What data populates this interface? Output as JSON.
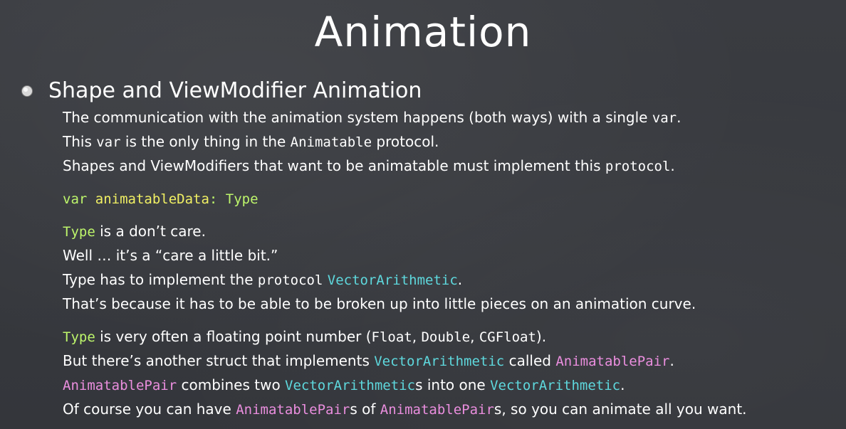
{
  "slide": {
    "title": "Animation",
    "bullet": {
      "icon": "bullet-circle-icon",
      "heading": "Shape and ViewModifier Animation"
    },
    "paragraphs": [
      [
        {
          "t": "The communication with the animation system happens (both ways) with a single ",
          "c": "plain"
        },
        {
          "t": "var",
          "c": "plain",
          "mono": true
        },
        {
          "t": ".",
          "c": "plain"
        }
      ],
      [
        {
          "t": "This ",
          "c": "plain"
        },
        {
          "t": "var",
          "c": "plain",
          "mono": true
        },
        {
          "t": " is the only thing in the ",
          "c": "plain"
        },
        {
          "t": "Animatable",
          "c": "plain",
          "mono": true
        },
        {
          "t": " protocol.",
          "c": "plain"
        }
      ],
      [
        {
          "t": "Shapes and ViewModifiers that want to be animatable must implement this ",
          "c": "plain"
        },
        {
          "t": "protocol",
          "c": "plain",
          "mono": true
        },
        {
          "t": ".",
          "c": "plain"
        }
      ],
      "gap",
      [
        {
          "t": "var ",
          "c": "green",
          "mono": true
        },
        {
          "t": "animatableData",
          "c": "yellow",
          "mono": true
        },
        {
          "t": ": Type",
          "c": "green",
          "mono": true
        }
      ],
      "gap",
      [
        {
          "t": "Type",
          "c": "green",
          "mono": true
        },
        {
          "t": " is a don’t care.",
          "c": "plain"
        }
      ],
      [
        {
          "t": "Well … it’s a “care a little bit.”",
          "c": "plain"
        }
      ],
      [
        {
          "t": "Type has to implement the ",
          "c": "plain"
        },
        {
          "t": "protocol",
          "c": "plain",
          "mono": true
        },
        {
          "t": " ",
          "c": "plain"
        },
        {
          "t": "VectorArithmetic",
          "c": "cyan",
          "mono": true
        },
        {
          "t": ".",
          "c": "plain"
        }
      ],
      [
        {
          "t": "That’s because it has to be able to be broken up into little pieces on an animation curve.",
          "c": "plain"
        }
      ],
      "gap",
      [
        {
          "t": "Type",
          "c": "green",
          "mono": true
        },
        {
          "t": " is very often a floating point number (",
          "c": "plain"
        },
        {
          "t": "Float",
          "c": "plain",
          "mono": true
        },
        {
          "t": ", ",
          "c": "plain"
        },
        {
          "t": "Double",
          "c": "plain",
          "mono": true
        },
        {
          "t": ", ",
          "c": "plain"
        },
        {
          "t": "CGFloat",
          "c": "plain",
          "mono": true
        },
        {
          "t": ").",
          "c": "plain"
        }
      ],
      [
        {
          "t": "But there’s another struct that implements ",
          "c": "plain"
        },
        {
          "t": "VectorArithmetic",
          "c": "cyan",
          "mono": true
        },
        {
          "t": " called ",
          "c": "plain"
        },
        {
          "t": "AnimatablePair",
          "c": "pink",
          "mono": true
        },
        {
          "t": ".",
          "c": "plain"
        }
      ],
      [
        {
          "t": "AnimatablePair",
          "c": "pink",
          "mono": true
        },
        {
          "t": " combines two ",
          "c": "plain"
        },
        {
          "t": "VectorArithmetic",
          "c": "cyan",
          "mono": true
        },
        {
          "t": "s into one ",
          "c": "plain"
        },
        {
          "t": "VectorArithmetic",
          "c": "cyan",
          "mono": true
        },
        {
          "t": ".",
          "c": "plain"
        }
      ],
      [
        {
          "t": "Of course you can have ",
          "c": "plain"
        },
        {
          "t": "AnimatablePair",
          "c": "pink",
          "mono": true
        },
        {
          "t": "s of ",
          "c": "plain"
        },
        {
          "t": "AnimatablePair",
          "c": "pink",
          "mono": true
        },
        {
          "t": "s, so you can animate all you want.",
          "c": "plain"
        }
      ]
    ]
  },
  "colors": {
    "background": "#37393e",
    "text": "#ffffff",
    "keyword_green": "#bdf56b",
    "identifier_yellow": "#f0ef63",
    "protocol_cyan": "#5ed8dd",
    "struct_pink": "#ea8ede"
  }
}
